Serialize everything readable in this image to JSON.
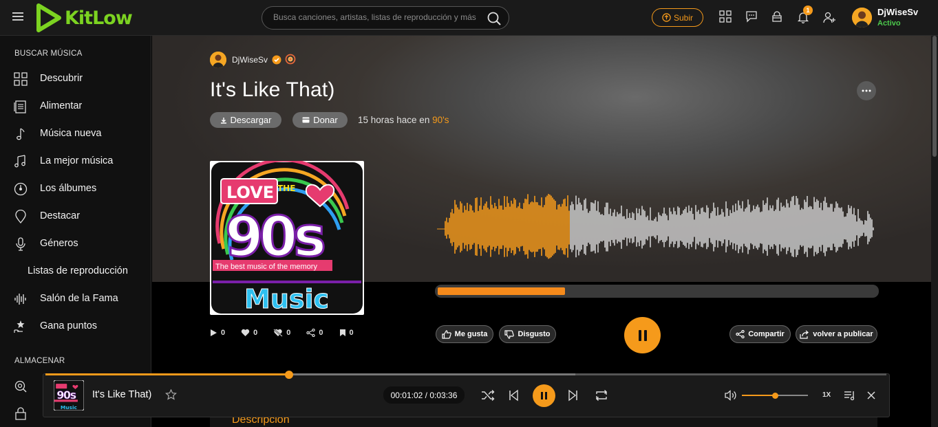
{
  "app": {
    "name": "KitLow"
  },
  "search": {
    "placeholder": "Busca canciones, artistas, listas de reproducción y más"
  },
  "header": {
    "upload_label": "Subir",
    "notification_count": "1",
    "user": {
      "name": "DjWiseSv",
      "status": "Activo"
    }
  },
  "sidebar": {
    "browse_header": "BUSCAR MÚSICA",
    "items": [
      {
        "label": "Descubrir",
        "icon": "grid-icon"
      },
      {
        "label": "Alimentar",
        "icon": "feed-icon"
      },
      {
        "label": "Música nueva",
        "icon": "music-note-icon"
      },
      {
        "label": "La mejor música",
        "icon": "music-notes-icon"
      },
      {
        "label": "Los álbumes",
        "icon": "album-icon"
      },
      {
        "label": "Destacar",
        "icon": "pin-icon"
      },
      {
        "label": "Géneros",
        "icon": "microphone-icon"
      },
      {
        "label": "Listas de reproducción",
        "icon": ""
      },
      {
        "label": "Salón de la Fama",
        "icon": "soundwave-icon"
      },
      {
        "label": "Gana puntos",
        "icon": "points-icon"
      }
    ],
    "store_header": "ALMACENAR"
  },
  "track": {
    "artist": "DjWiseSv",
    "title": "It's Like That)",
    "download_label": "Descargar",
    "donate_label": "Donar",
    "posted_text": "15 horas hace en",
    "category": "90's",
    "cover": {
      "line1": "LOVE",
      "line1_small": "THE",
      "line2": "90s",
      "tagline": "The best music of the memory",
      "line3": "Music"
    },
    "progress_fraction": 0.29,
    "stats": {
      "plays": "0",
      "likes": "0",
      "dislikes": "0",
      "shares": "0",
      "saves": "0"
    },
    "like_label": "Me gusta",
    "dislike_label": "Disgusto",
    "share_label": "Compartir",
    "repost_label": "volver a publicar",
    "description_label": "Descripción"
  },
  "player": {
    "title": "It's Like That)",
    "time": "00:01:02 / 0:03:36",
    "speed": "1X",
    "progress_fraction": 0.29,
    "volume_fraction": 0.5
  },
  "colors": {
    "accent": "#f59a1b",
    "brand": "#7cd321",
    "status": "#4cc84c"
  }
}
